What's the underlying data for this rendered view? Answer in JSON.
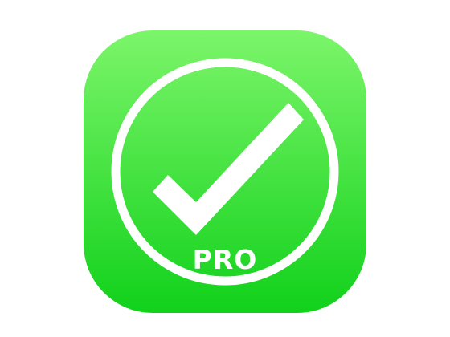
{
  "icon": {
    "badge_text": "PRO",
    "symbol": "checkmark-in-circle-icon",
    "colors": {
      "gradient_top": "#7CF56A",
      "gradient_bottom": "#11D11B",
      "foreground": "#FFFFFF",
      "background": "#FFFFFF"
    }
  }
}
